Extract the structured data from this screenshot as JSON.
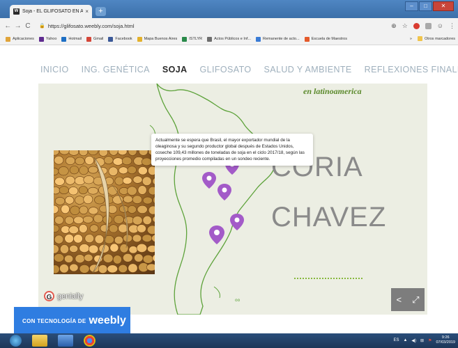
{
  "browser": {
    "tab_title": "Soja - EL GLIFOSATO EN ARGEN",
    "tab_favicon": "W",
    "tab_close": "×",
    "new_tab": "+",
    "url": "https://glifosato.weebly.com/soja.html",
    "bookmarks": [
      {
        "label": "Aplicaciones",
        "color": "#e0a43a"
      },
      {
        "label": "Yahoo",
        "color": "#5f2b8f"
      },
      {
        "label": "Hotmail",
        "color": "#1e6fc4"
      },
      {
        "label": "Gmail",
        "color": "#d44638"
      },
      {
        "label": "Facebook",
        "color": "#3b5998"
      },
      {
        "label": "Mapa Buenos Aires",
        "color": "#e3b12b"
      },
      {
        "label": "ISTLYR",
        "color": "#2a8a4a"
      },
      {
        "label": "Actos Públicos e Inf...",
        "color": "#6d6d6d"
      },
      {
        "label": "Remanente de acto...",
        "color": "#3a7bd5"
      },
      {
        "label": "Escuela de Maestros",
        "color": "#e45a2b"
      }
    ],
    "bookmarks_more": "»",
    "other_bookmarks": "Otros marcadores"
  },
  "site_nav": {
    "items": [
      {
        "label": "INICIO",
        "active": false
      },
      {
        "label": "ING. GENÉTICA",
        "active": false
      },
      {
        "label": "SOJA",
        "active": true
      },
      {
        "label": "GLIFOSATO",
        "active": false
      },
      {
        "label": "SALUD Y AMBIENTE",
        "active": false
      },
      {
        "label": "REFLEXIONES FINALES",
        "active": false
      }
    ]
  },
  "content": {
    "subtitle": "en latinoamerica",
    "tooltip": "Actualmente se espera que Brasil, el mayor exportador mundial de la oleaginosa y su segundo productor global después de Estados Unidos, coseche 109,43 millones de toneladas de soja en el ciclo 2017/18, según las proyecciones promedio compiladas en un sondeo reciente.",
    "name_line1": "CORIA",
    "name_line2": "CHAVEZ",
    "genially_label": "genially",
    "genially_logo": "G"
  },
  "footer": {
    "prefix": "CON TECNOLOGÍA DE",
    "brand": "weebly"
  },
  "taskbar": {
    "language": "ES",
    "time": "9:26",
    "date": "07/03/2019"
  },
  "colors": {
    "accent_green": "#5c8a2d",
    "pin_purple": "#a35bc8",
    "weebly_blue": "#2f7de1"
  }
}
